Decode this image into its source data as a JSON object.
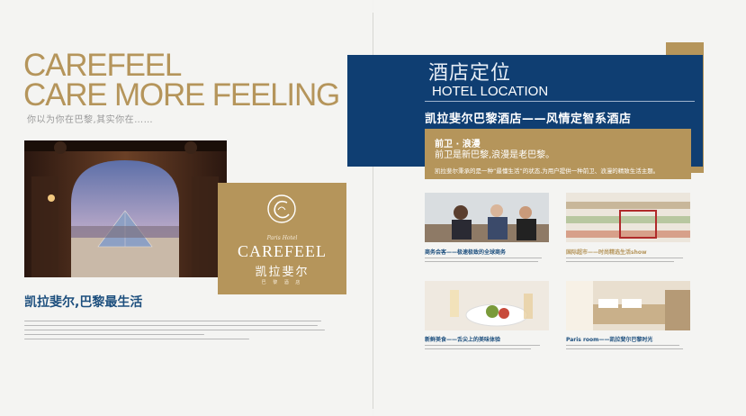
{
  "left_page": {
    "title_line1": "CAREFEEL",
    "title_line2": "CARE MORE FEELING",
    "tagline": "你以为你在巴黎,其实你在……",
    "logo": {
      "script": "Paris Hotel",
      "name": "CAREFEEL",
      "chinese": "凯拉斐尔",
      "small": "巴 黎 酒 店"
    },
    "heading": "凯拉斐尔,巴黎最生活"
  },
  "right_page": {
    "section_cn": "酒店定位",
    "section_en": "HOTEL LOCATION",
    "hotel_name": "凯拉斐尔巴黎酒店——风情定智系酒店",
    "panel": {
      "title": "前卫 · 浪漫",
      "subtitle": "前卫是新巴黎,浪漫是老巴黎。",
      "desc": "凯拉斐尔秉承的是一种“最懂生活”的状态,为用户提供一种前卫、浪漫的精致生活主题。"
    },
    "cards": [
      {
        "title": "商务会客——极速极致的全球商务"
      },
      {
        "title": "国际超市——时尚精选生活show"
      },
      {
        "title": "新鲜美食——舌尖上的美味体验"
      },
      {
        "title": "Paris room——凯拉斐尔巴黎时光"
      }
    ]
  },
  "colors": {
    "gold": "#b5955b",
    "navy": "#0f3e72",
    "heading_blue": "#1d4f7e"
  }
}
